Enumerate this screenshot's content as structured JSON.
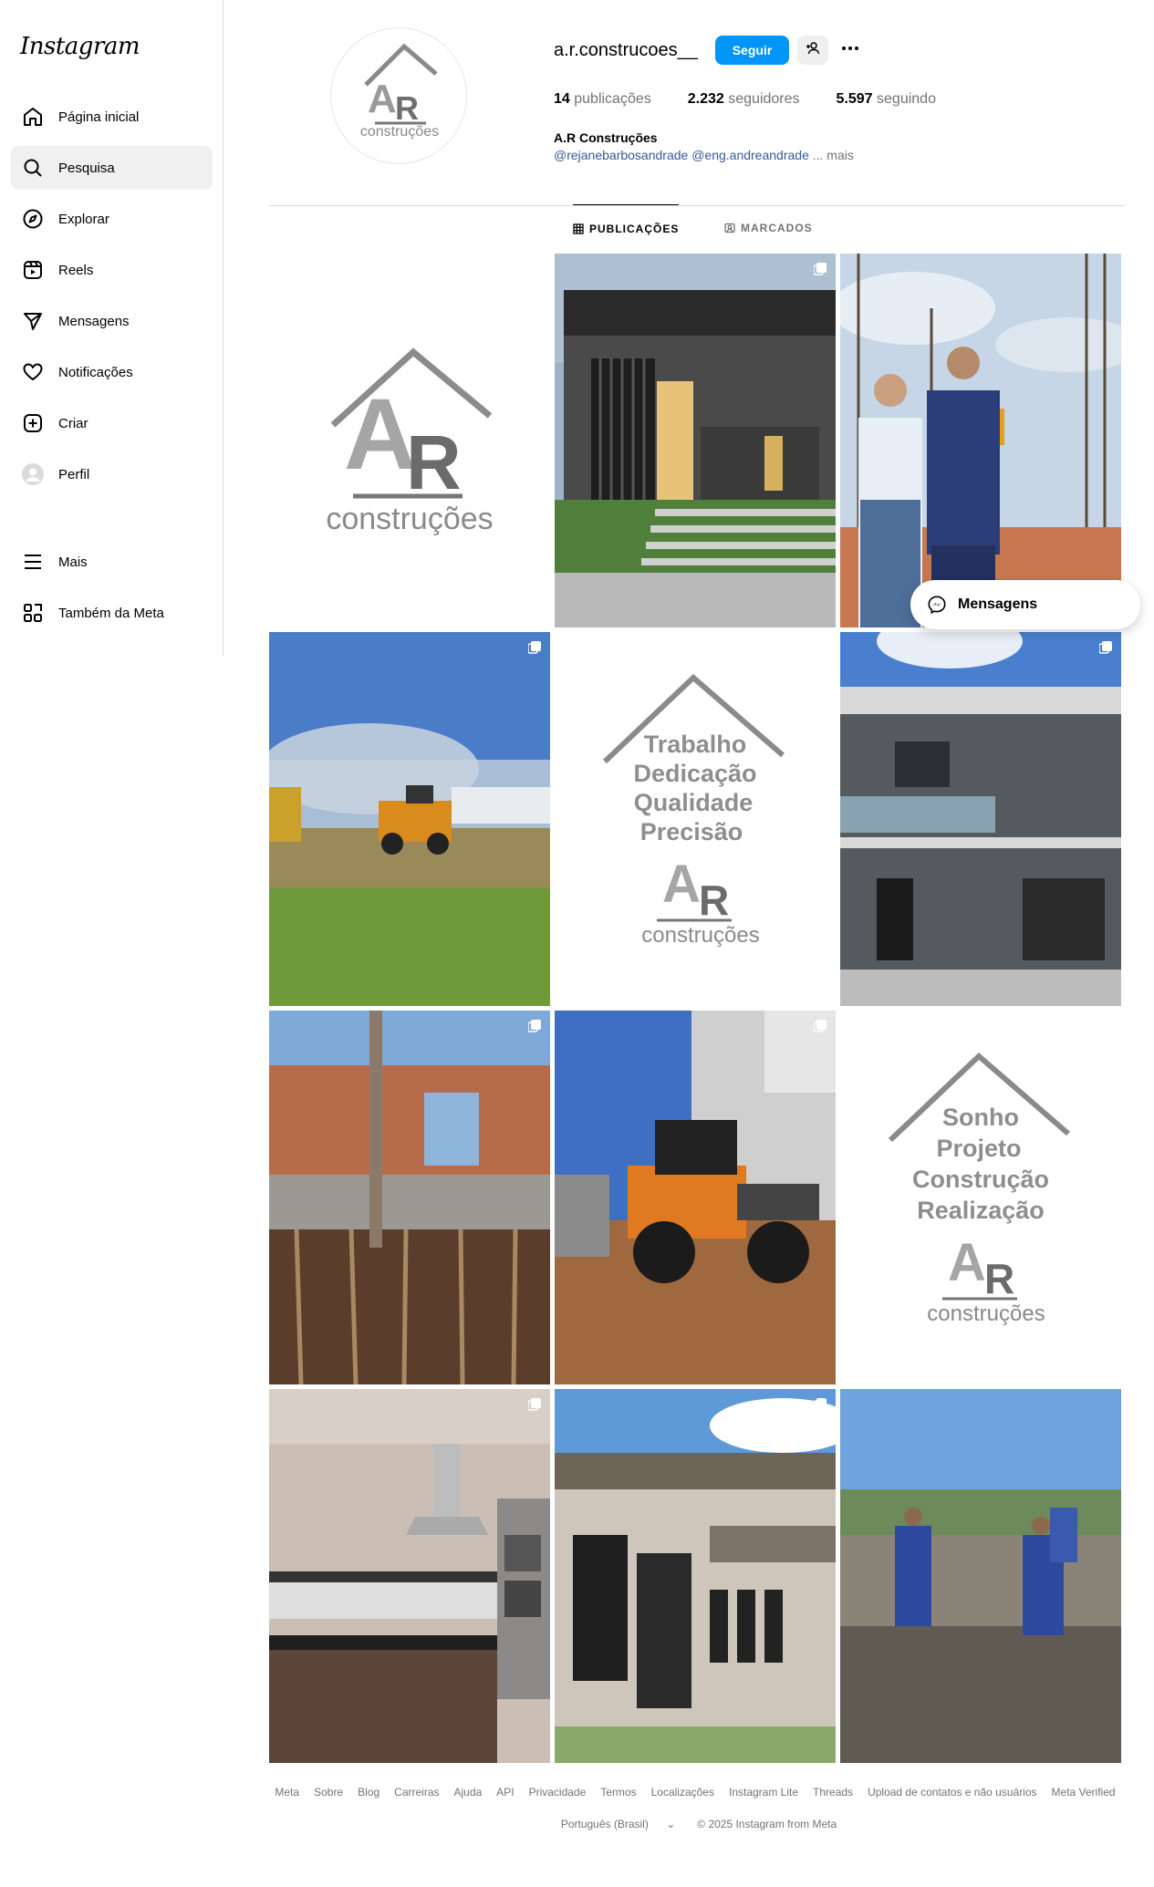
{
  "app": {
    "logo": "Instagram"
  },
  "sidebar": {
    "items": [
      {
        "label": "Página inicial",
        "icon": "home-icon"
      },
      {
        "label": "Pesquisa",
        "icon": "search-icon",
        "active": true
      },
      {
        "label": "Explorar",
        "icon": "compass-icon"
      },
      {
        "label": "Reels",
        "icon": "reels-icon"
      },
      {
        "label": "Mensagens",
        "icon": "send-icon"
      },
      {
        "label": "Notificações",
        "icon": "heart-icon"
      },
      {
        "label": "Criar",
        "icon": "plus-square-icon"
      },
      {
        "label": "Perfil",
        "icon": "profile-avatar"
      }
    ],
    "bottom": [
      {
        "label": "Mais",
        "icon": "menu-icon"
      },
      {
        "label": "Também da Meta",
        "icon": "meta-apps-icon"
      }
    ]
  },
  "profile": {
    "username": "a.r.construcoes__",
    "follow_label": "Seguir",
    "stats": {
      "posts_count": "14",
      "posts_label": "publicações",
      "followers_count": "2.232",
      "followers_label": "seguidores",
      "following_count": "5.597",
      "following_label": "seguindo"
    },
    "full_name": "A.R Construções",
    "bio_mentions": "@rejanebarbosandrade @eng.andreandrade",
    "bio_more": "... mais",
    "avatar_logo_text": "construções"
  },
  "tabs": [
    {
      "label": "PUBLICAÇÕES",
      "icon": "grid-icon",
      "active": true
    },
    {
      "label": "MARCADOS",
      "icon": "tag-icon",
      "active": false
    }
  ],
  "posts": [
    {
      "kind": "logo",
      "logo_text": "construções"
    },
    {
      "kind": "photo",
      "subject": "modern-house-facade",
      "multi": true
    },
    {
      "kind": "photo",
      "subject": "couple-at-construction-site",
      "multi": false
    },
    {
      "kind": "photo",
      "subject": "loader-clearing-land",
      "multi": true
    },
    {
      "kind": "logo-text",
      "lines": [
        "Trabalho",
        "Dedicação",
        "Qualidade",
        "Precisão"
      ],
      "logo_text": "construções"
    },
    {
      "kind": "photo",
      "subject": "two-story-house",
      "multi": true
    },
    {
      "kind": "photo",
      "subject": "brick-walls-under-construction",
      "multi": true
    },
    {
      "kind": "photo",
      "subject": "case-loader-truck",
      "multi": true
    },
    {
      "kind": "logo-text",
      "lines": [
        "Sonho",
        "Projeto",
        "Construção",
        "Realização"
      ],
      "logo_text": "construções"
    },
    {
      "kind": "photo",
      "subject": "kitchen-interior",
      "multi": true
    },
    {
      "kind": "photo",
      "subject": "house-facade-door",
      "multi": true
    },
    {
      "kind": "photo",
      "subject": "workers-pouring-concrete",
      "multi": false
    }
  ],
  "messages_pill": {
    "label": "Mensagens"
  },
  "footer": {
    "links": [
      "Meta",
      "Sobre",
      "Blog",
      "Carreiras",
      "Ajuda",
      "API",
      "Privacidade",
      "Termos",
      "Localizações",
      "Instagram Lite",
      "Threads",
      "Upload de contatos e não usuários",
      "Meta Verified"
    ],
    "language": "Português (Brasil)",
    "copyright": "© 2025 Instagram from Meta"
  }
}
